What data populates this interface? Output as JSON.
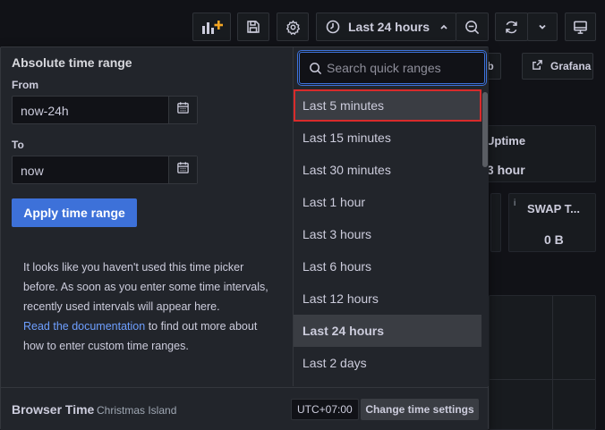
{
  "toolbar": {
    "add_panel_icon": "bar-chart-plus-icon",
    "save_icon": "save-icon",
    "settings_icon": "gear-icon",
    "time_range_label": "Last 24 hours",
    "clock_icon": "clock-icon",
    "zoom_icon": "zoom-out-icon",
    "refresh_icon": "refresh-icon",
    "tv_icon": "monitor-icon",
    "accent_color": "#f5a623"
  },
  "dashboard": {
    "link_button_partial": "b",
    "grafana_button": "Grafana",
    "uptime_title": "Uptime",
    "uptime_value": ".3 hour",
    "swap_title": "SWAP T...",
    "swap_value": "0 B",
    "swap_info": "i"
  },
  "picker": {
    "absolute_title": "Absolute time range",
    "from_label": "From",
    "from_value": "now-24h",
    "to_label": "To",
    "to_value": "now",
    "apply_label": "Apply time range",
    "help_text": "It looks like you haven't used this time picker before. As soon as you enter some time intervals, recently used intervals will appear here.",
    "help_link": "Read the documentation",
    "help_suffix": " to find out more about how to enter custom time ranges.",
    "search_placeholder": "Search quick ranges",
    "quick_ranges": [
      "Last 5 minutes",
      "Last 15 minutes",
      "Last 30 minutes",
      "Last 1 hour",
      "Last 3 hours",
      "Last 6 hours",
      "Last 12 hours",
      "Last 24 hours",
      "Last 2 days"
    ],
    "selected_range": "Last 24 hours",
    "highlight_color": "#d92b2b",
    "timezone_label": "Browser Time",
    "timezone_region": "Christmas Island",
    "timezone_offset": "UTC+07:00",
    "change_settings_label": "Change time settings",
    "primary_color": "#3d71d9"
  }
}
